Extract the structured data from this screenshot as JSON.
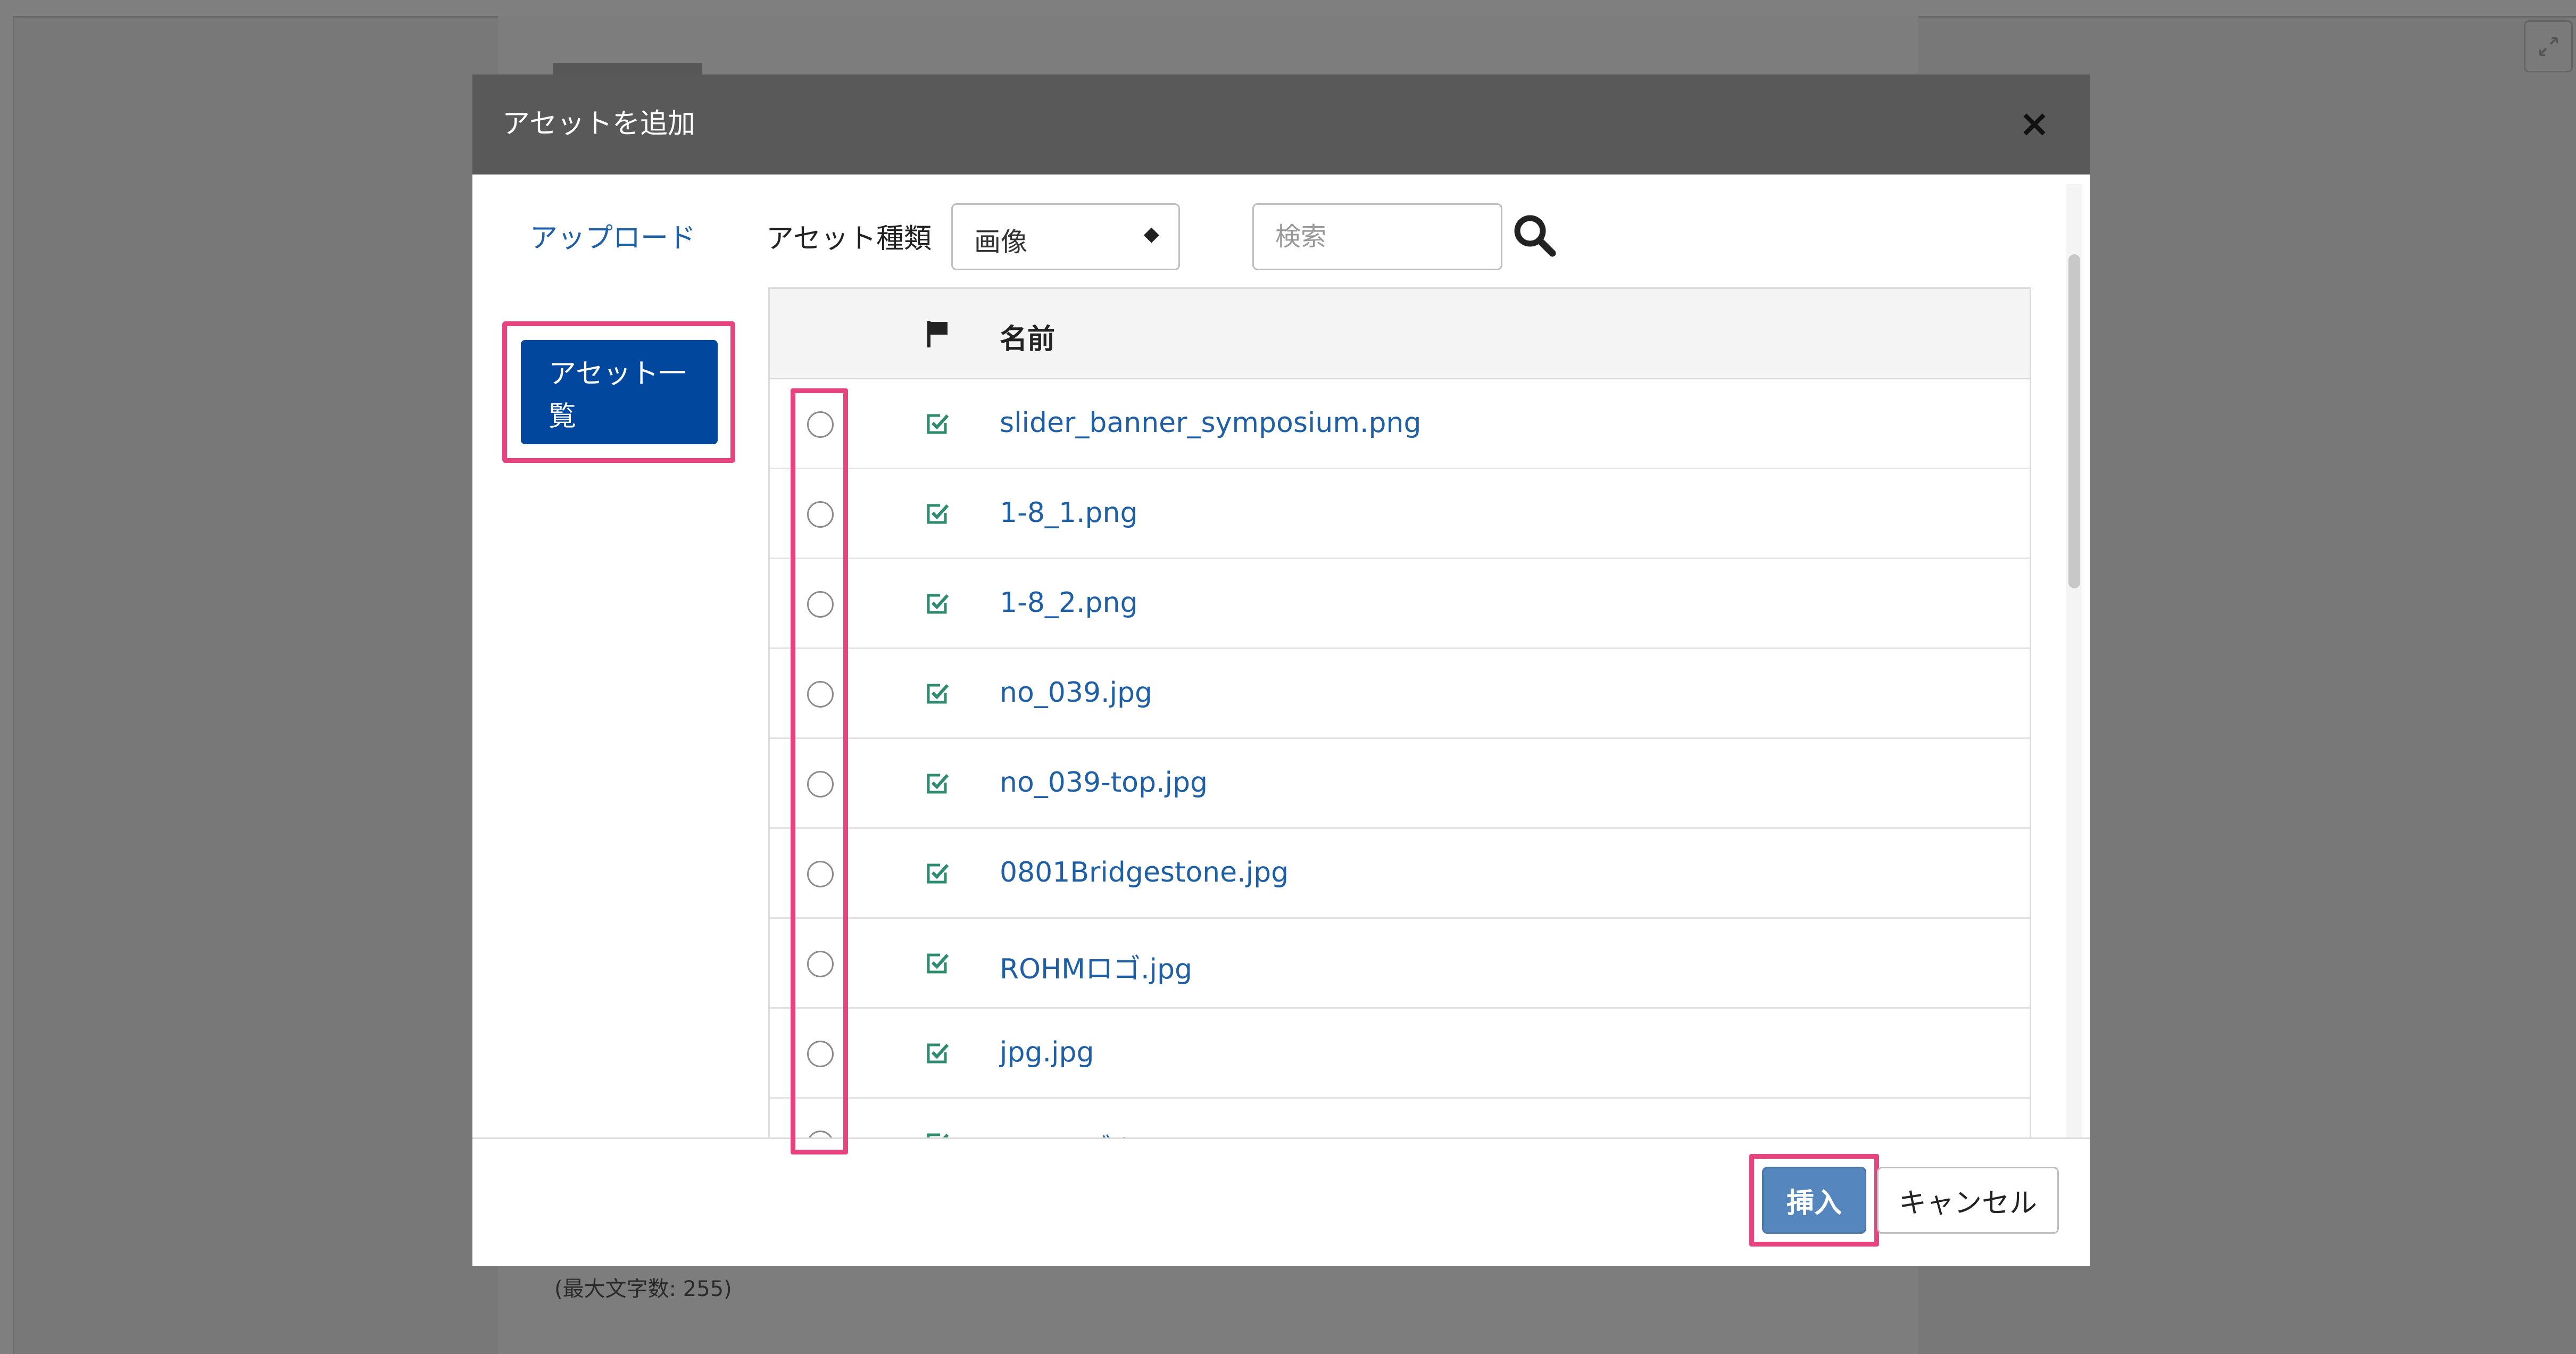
{
  "page": {
    "max_length_note": "(最大文字数: 255)"
  },
  "modal": {
    "title": "アセットを追加",
    "close_icon": "×"
  },
  "nav": {
    "items": [
      {
        "label": "アップロード",
        "active": false
      },
      {
        "label": "アセット一覧",
        "active": true
      }
    ]
  },
  "filters": {
    "type_label": "アセット種類",
    "type_value": "画像",
    "search_placeholder": "検索",
    "search_value": ""
  },
  "table": {
    "columns": {
      "select": "",
      "flag_icon": "flag-icon",
      "name": "名前"
    },
    "rows": [
      {
        "name": "slider_banner_symposium.png",
        "flagged": true,
        "selected": false
      },
      {
        "name": "1-8_1.png",
        "flagged": true,
        "selected": false
      },
      {
        "name": "1-8_2.png",
        "flagged": true,
        "selected": false
      },
      {
        "name": "no_039.jpg",
        "flagged": true,
        "selected": false
      },
      {
        "name": "no_039-top.jpg",
        "flagged": true,
        "selected": false
      },
      {
        "name": "0801Bridgestone.jpg",
        "flagged": true,
        "selected": false
      },
      {
        "name": "ROHMロゴ.jpg",
        "flagged": true,
        "selected": false
      },
      {
        "name": "jpg.jpg",
        "flagged": true,
        "selected": false
      },
      {
        "name": "NSKロゴ.jpg",
        "flagged": true,
        "selected": false
      }
    ]
  },
  "footer": {
    "insert_label": "挿入",
    "cancel_label": "キャンセル"
  },
  "colors": {
    "accent": "#00479d",
    "highlight": "#e7437f",
    "link": "#1f5fa6",
    "check": "#2e8b6e",
    "insert_button": "#5586bd"
  }
}
